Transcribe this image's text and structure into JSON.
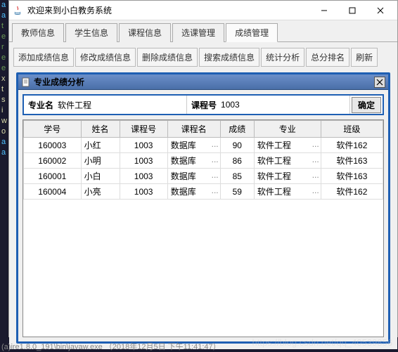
{
  "window": {
    "title": "欢迎来到小白教务系统"
  },
  "tabs": [
    "教师信息",
    "学生信息",
    "课程信息",
    "选课管理",
    "成绩管理"
  ],
  "active_tab_index": 4,
  "toolbar": [
    "添加成绩信息",
    "修改成绩信息",
    "删除成绩信息",
    "搜索成绩信息",
    "统计分析",
    "总分排名",
    "刷新"
  ],
  "inner_frame": {
    "title": "专业成绩分析"
  },
  "filter": {
    "major_label": "专业名",
    "major_value": "软件工程",
    "course_label": "课程号",
    "course_value": "1003",
    "confirm": "确定"
  },
  "table": {
    "headers": [
      "学号",
      "姓名",
      "课程号",
      "课程名",
      "成绩",
      "专业",
      "班级"
    ],
    "rows": [
      {
        "id": "160003",
        "name": "小红",
        "cno": "1003",
        "cname": "数据库",
        "score": "90",
        "major": "软件工程",
        "class": "软件162"
      },
      {
        "id": "160002",
        "name": "小明",
        "cno": "1003",
        "cname": "数据库",
        "score": "86",
        "major": "软件工程",
        "class": "软件163"
      },
      {
        "id": "160001",
        "name": "小白",
        "cno": "1003",
        "cname": "数据库",
        "score": "85",
        "major": "软件工程",
        "class": "软件163"
      },
      {
        "id": "160004",
        "name": "小亮",
        "cno": "1003",
        "cname": "数据库",
        "score": "59",
        "major": "软件工程",
        "class": "软件162"
      }
    ]
  },
  "left_chars": [
    "a",
    "a",
    "t",
    "e",
    "r",
    "e",
    "e",
    " ",
    "x",
    "t",
    "s",
    "i",
    " ",
    "w",
    "o",
    " ",
    "a",
    "a"
  ],
  "watermark": "https://blog.csdn.net/qq_40539856",
  "footer": "(a)ire1.8.0_191\\bin\\javaw.exe （2018年12月5日 下午11:41:47）"
}
